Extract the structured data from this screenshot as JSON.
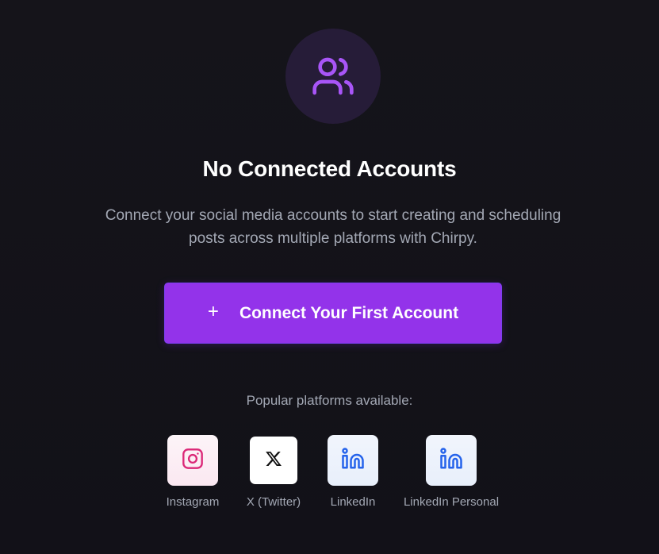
{
  "empty_state": {
    "icon": "users-icon",
    "title": "No Connected Accounts",
    "description": "Connect your social media accounts to start creating and scheduling posts across multiple platforms with Chirpy.",
    "button": {
      "icon": "plus-icon",
      "icon_glyph": "+",
      "label": "Connect Your First Account"
    },
    "popular_label": "Popular platforms available:",
    "platforms": [
      {
        "name": "Instagram",
        "icon": "instagram-icon"
      },
      {
        "name": "X (Twitter)",
        "icon": "x-twitter-icon"
      },
      {
        "name": "LinkedIn",
        "icon": "linkedin-icon"
      },
      {
        "name": "LinkedIn Personal",
        "icon": "linkedin-icon"
      }
    ]
  },
  "colors": {
    "background": "#15141a",
    "accent": "#9333ea",
    "icon_circle": "#261c38",
    "icon_purple": "#a855f7",
    "muted_text": "#a3a8b4",
    "instagram": "#db2777",
    "linkedin": "#2563eb"
  }
}
